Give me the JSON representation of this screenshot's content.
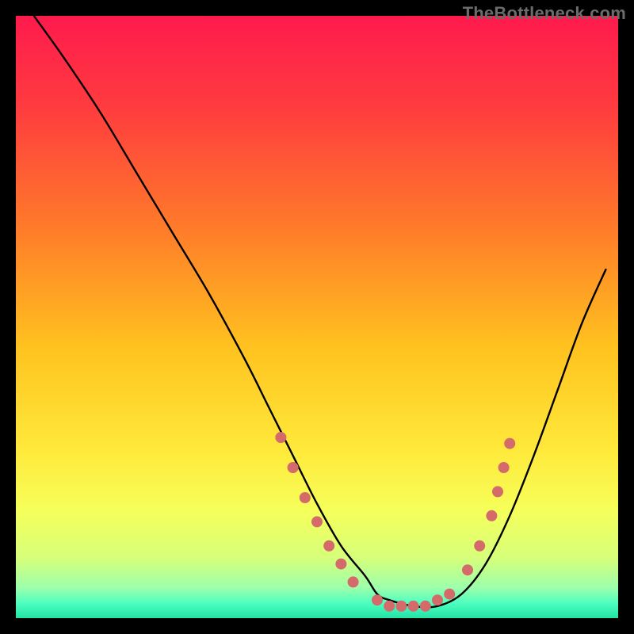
{
  "watermark": "TheBottleneck.com",
  "colors": {
    "bg": "#000000",
    "gradient_stops": [
      {
        "offset": 0.0,
        "color": "#ff1a4d"
      },
      {
        "offset": 0.15,
        "color": "#ff3b3f"
      },
      {
        "offset": 0.35,
        "color": "#ff7a2a"
      },
      {
        "offset": 0.55,
        "color": "#ffc21f"
      },
      {
        "offset": 0.72,
        "color": "#ffe93a"
      },
      {
        "offset": 0.82,
        "color": "#f6ff5a"
      },
      {
        "offset": 0.9,
        "color": "#d6ff7a"
      },
      {
        "offset": 0.95,
        "color": "#9cffab"
      },
      {
        "offset": 0.975,
        "color": "#4effc0"
      },
      {
        "offset": 1.0,
        "color": "#22e3a4"
      }
    ],
    "curve": "#000000",
    "marker": "#d46a6a"
  },
  "chart_data": {
    "type": "line",
    "title": "",
    "xlabel": "",
    "ylabel": "",
    "xlim": [
      0,
      100
    ],
    "ylim": [
      0,
      100
    ],
    "grid": false,
    "legend": false,
    "annotations": [],
    "series": [
      {
        "name": "curve",
        "x": [
          3,
          8,
          14,
          20,
          26,
          32,
          38,
          42,
          46,
          50,
          54,
          58,
          60,
          62,
          66,
          70,
          74,
          78,
          82,
          86,
          90,
          94,
          98
        ],
        "y": [
          100,
          93,
          84,
          74,
          64,
          54,
          43,
          35,
          27,
          19,
          12,
          7,
          4,
          3,
          2,
          2,
          4,
          9,
          17,
          27,
          38,
          49,
          58
        ]
      }
    ],
    "markers": [
      {
        "x": 44,
        "y": 30
      },
      {
        "x": 46,
        "y": 25
      },
      {
        "x": 48,
        "y": 20
      },
      {
        "x": 50,
        "y": 16
      },
      {
        "x": 52,
        "y": 12
      },
      {
        "x": 54,
        "y": 9
      },
      {
        "x": 56,
        "y": 6
      },
      {
        "x": 60,
        "y": 3
      },
      {
        "x": 62,
        "y": 2
      },
      {
        "x": 64,
        "y": 2
      },
      {
        "x": 66,
        "y": 2
      },
      {
        "x": 68,
        "y": 2
      },
      {
        "x": 70,
        "y": 3
      },
      {
        "x": 72,
        "y": 4
      },
      {
        "x": 75,
        "y": 8
      },
      {
        "x": 77,
        "y": 12
      },
      {
        "x": 79,
        "y": 17
      },
      {
        "x": 80,
        "y": 21
      },
      {
        "x": 81,
        "y": 25
      },
      {
        "x": 82,
        "y": 29
      }
    ]
  }
}
